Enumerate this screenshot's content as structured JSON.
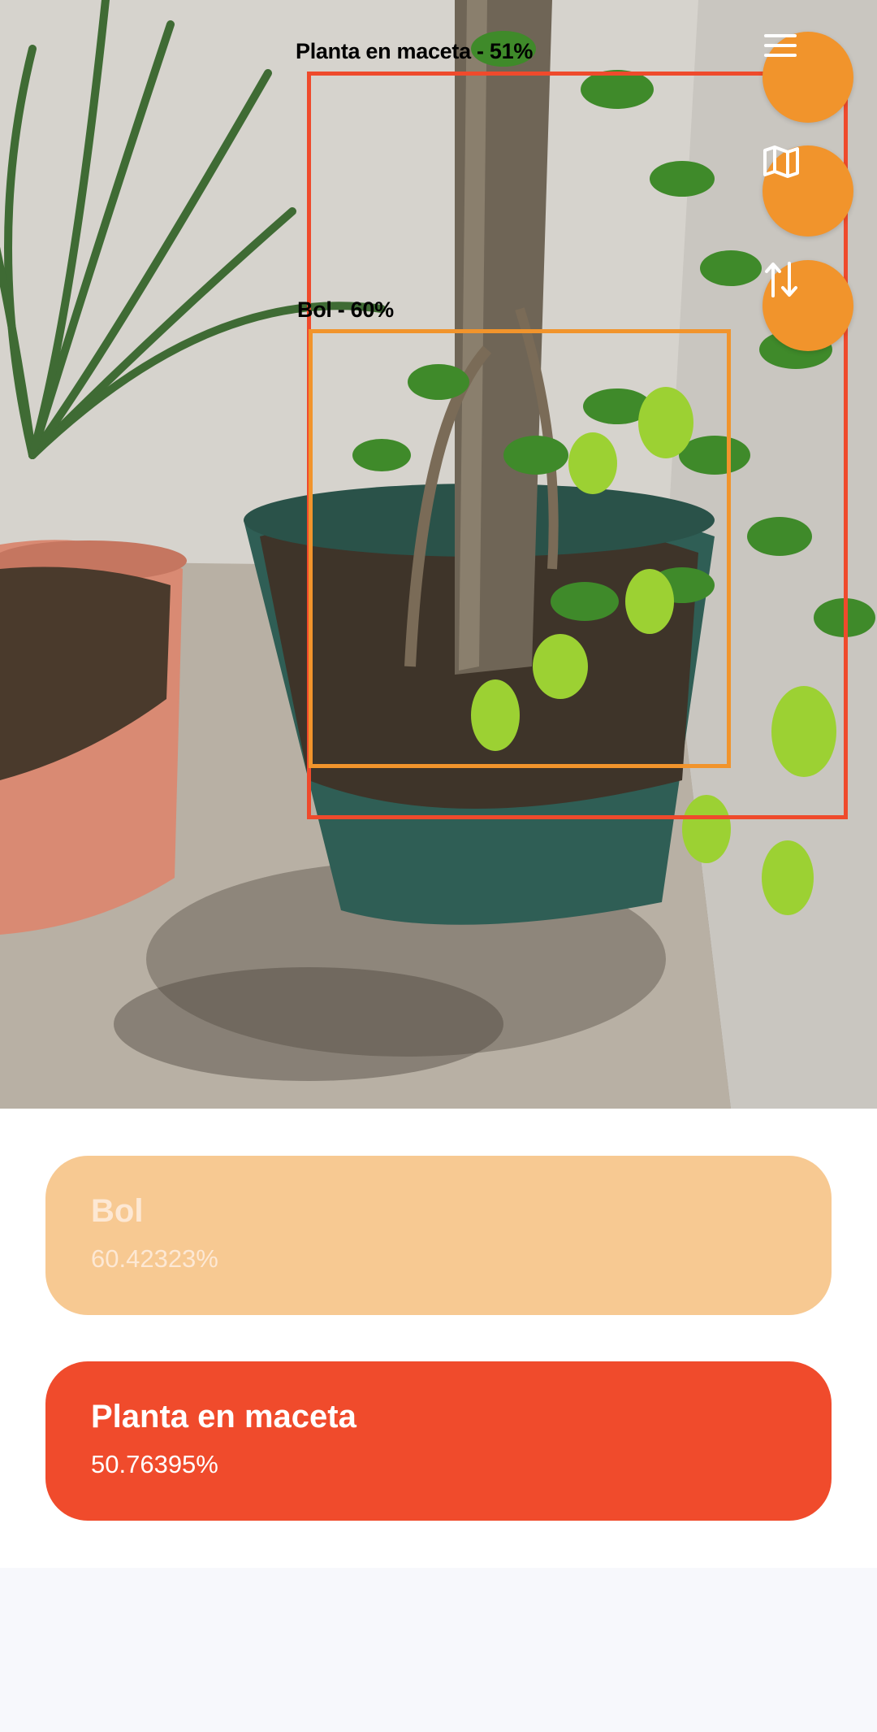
{
  "detections": [
    {
      "label": "Planta en maceta - 51%",
      "color": "#ef4a2c"
    },
    {
      "label": "Bol - 60%",
      "color": "#f1942c"
    }
  ],
  "fab_buttons": [
    {
      "icon": "menu-icon"
    },
    {
      "icon": "map-icon"
    },
    {
      "icon": "swap-vertical-icon"
    }
  ],
  "results": [
    {
      "title": "Bol",
      "value": "60.42323%",
      "color": "#f7c992"
    },
    {
      "title": "Planta en maceta",
      "value": "50.76395%",
      "color": "#f04b2c"
    }
  ],
  "colors": {
    "accent": "#f1942c",
    "detection_red": "#ef4a2c",
    "page_bg": "#f7f8fc"
  }
}
